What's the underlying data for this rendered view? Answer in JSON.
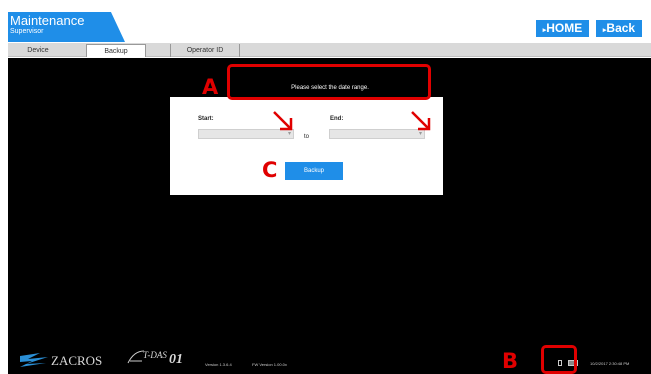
{
  "header": {
    "title": "Maintenance",
    "subtitle": "Supervisor",
    "home_label": "HOME",
    "back_label": "Back",
    "nav_icon": "triangle-right-icon"
  },
  "tabs": [
    {
      "label": "Device"
    },
    {
      "label": "Backup",
      "active": true
    },
    {
      "label": "Operator ID"
    }
  ],
  "main": {
    "prompt": "Please select the date range.",
    "start_label": "Start:",
    "end_label": "End:",
    "to_label": "to",
    "backup_label": "Backup",
    "start_value": "",
    "end_value": ""
  },
  "annotations": {
    "a": "A",
    "b": "B",
    "c": "C",
    "color": "#e00000"
  },
  "footer": {
    "brand": "ZACROS",
    "product_name": "T-DAS",
    "product_number": "01",
    "version_sw": "Version 1.3.6.4",
    "version_fw": "FW Version 1.00.0x",
    "datetime": "10/2/2017 2:30:48 PM"
  },
  "colors": {
    "accent": "#1f8ee8",
    "background_main": "#000000"
  }
}
